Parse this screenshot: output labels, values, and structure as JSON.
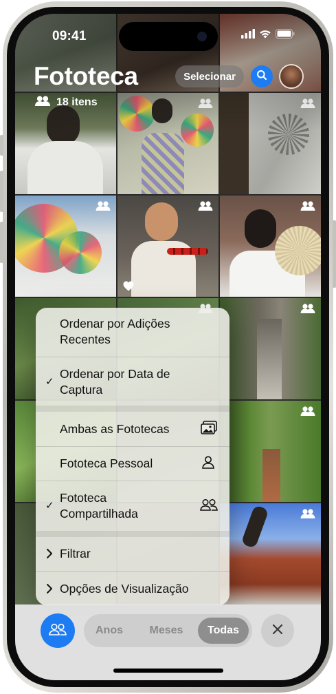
{
  "status_bar": {
    "time": "09:41"
  },
  "header": {
    "title": "Fototeca",
    "items_count": "18 itens",
    "select_label": "Selecionar"
  },
  "menu": {
    "sort_recent": "Ordenar por Adições Recentes",
    "sort_capture": "Ordenar por Data de Captura",
    "library_both": "Ambas as Fototecas",
    "library_personal": "Fototeca Pessoal",
    "library_shared": "Fototeca Compartilhada",
    "filter": "Filtrar",
    "view_options": "Opções de Visualização",
    "checked_sort": "Ordenar por Data de Captura",
    "checked_library": "Fototeca Compartilhada"
  },
  "toolbar": {
    "segments": [
      "Anos",
      "Meses",
      "Todas"
    ],
    "active_segment": "Todas"
  },
  "icons": {
    "shared": "people-icon",
    "favorite": "heart-icon",
    "search": "search-icon",
    "close": "close-icon",
    "both_libraries": "photo-stack-icon",
    "personal": "person-icon"
  },
  "colors": {
    "accent": "#1e7cf2"
  }
}
